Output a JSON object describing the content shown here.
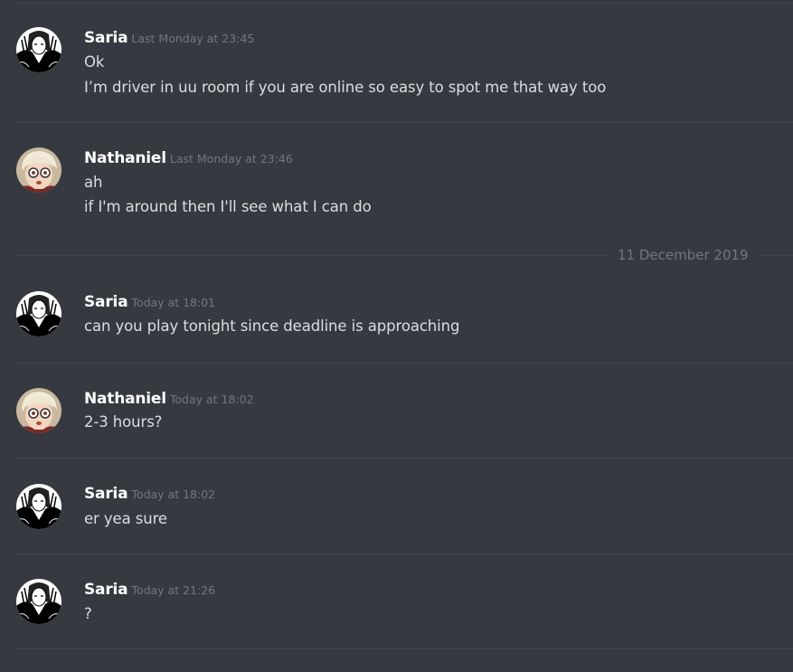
{
  "messages": [
    {
      "author": "Saria",
      "timestamp": "Last Monday at 23:45",
      "lines": [
        "Ok",
        "I’m driver in uu room if you are online so easy to spot me that way too"
      ]
    },
    {
      "author": "Nathaniel",
      "timestamp": "Last Monday at 23:46",
      "lines": [
        "ah",
        "if I'm around then I'll see what I can do"
      ]
    },
    {
      "author": "Saria",
      "timestamp": "Today at 18:01",
      "lines": [
        "can you play tonight since deadline is approaching"
      ]
    },
    {
      "author": "Nathaniel",
      "timestamp": "Today at 18:02",
      "lines": [
        "2-3 hours?"
      ]
    },
    {
      "author": "Saria",
      "timestamp": "Today at 18:02",
      "lines": [
        "er yea sure"
      ]
    },
    {
      "author": "Saria",
      "timestamp": "Today at 21:26",
      "lines": [
        "?"
      ]
    }
  ],
  "date_separator": "11 December 2019",
  "avatars": {
    "Saria": "manga-girl-avatar-icon",
    "Nathaniel": "anime-boy-glasses-avatar-icon"
  },
  "colors": {
    "background": "#36393f",
    "username": "#ffffff",
    "message_text": "#dcddde",
    "timestamp": "#72767d",
    "divider": "#43464c"
  }
}
